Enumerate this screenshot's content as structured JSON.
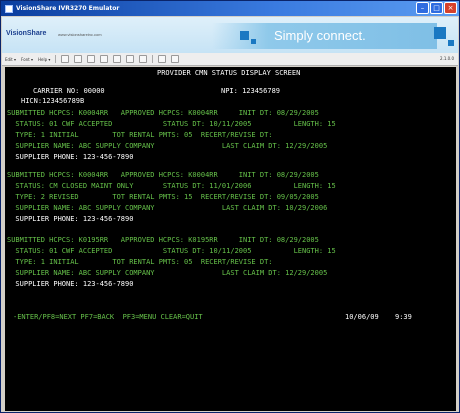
{
  "window": {
    "title": "VisionShare IVR3270 Emulator"
  },
  "banner": {
    "logo": "VisionShare",
    "url": "www.visionshareinc.com",
    "slogan": "Simply connect."
  },
  "toolbar": {
    "menu_edit": "Edit ▾",
    "menu_font": "Font ▾",
    "menu_help": "Help ▾",
    "version": "2.1.0.0"
  },
  "terminal": {
    "header": "PROVIDER CMN STATUS DISPLAY SCREEN",
    "carrier_line": "CARRIER NO: 00000",
    "npi_line": "NPI: 123456789",
    "hicn_line": "HICN:123456789B",
    "records": [
      {
        "line1": "SUBMITTED HCPCS: K0004RR   APPROVED HCPCS: K0004RR     INIT DT: 08/29/2005",
        "line2": "  STATUS: 01 CWF ACCEPTED            STATUS DT: 10/11/2005          LENGTH: 15",
        "line3": "  TYPE: 1 INITIAL        TOT RENTAL PMTS: 05  RECERT/REVISE DT:",
        "line4": "  SUPPLIER NAME: ABC SUPPLY COMPANY                LAST CLAIM DT: 12/29/2005",
        "line5": "  SUPPLIER PHONE: 123-456-7890"
      },
      {
        "line1": "SUBMITTED HCPCS: K0004RR   APPROVED HCPCS: K0004RR     INIT DT: 08/29/2005",
        "line2": "  STATUS: CM CLOSED MAINT ONLY       STATUS DT: 11/01/2006          LENGTH: 15",
        "line3": "  TYPE: 2 REVISED        TOT RENTAL PMTS: 15  RECERT/REVISE DT: 09/05/2005",
        "line4": "  SUPPLIER NAME: ABC SUPPLY COMPANY                LAST CLAIM DT: 10/29/2006",
        "line5": "  SUPPLIER PHONE: 123-456-7890"
      },
      {
        "line1": "SUBMITTED HCPCS: K0195RR   APPROVED HCPCS: K0195RR     INIT DT: 08/29/2005",
        "line2": "  STATUS: 01 CWF ACCEPTED            STATUS DT: 10/11/2005          LENGTH: 15",
        "line3": "  TYPE: 1 INITIAL        TOT RENTAL PMTS: 05  RECERT/REVISE DT:",
        "line4": "  SUPPLIER NAME: ABC SUPPLY COMPANY                LAST CLAIM DT: 12/29/2005",
        "line5": "  SUPPLIER PHONE: 123-456-7890"
      }
    ],
    "footer_keys": "-ENTER/PF8=NEXT PF7=BACK  PF3=MENU CLEAR=QUIT",
    "footer_date": "10/06/09",
    "footer_time": "9:39"
  },
  "colors": {
    "terminal_bg": "#000000",
    "terminal_text": "#66c24a",
    "terminal_bright": "#ffffff",
    "title_bar": "#0a3d9e"
  }
}
